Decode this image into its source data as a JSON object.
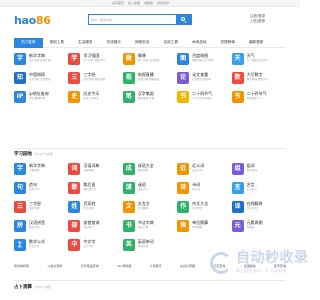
{
  "topbar": {
    "links": [
      "设为首页",
      "加入收藏",
      "电脑版",
      "商务合作"
    ]
  },
  "header": {
    "logo_text": "hao",
    "logo_num": "86",
    "search_placeholder": "网址 / 搜索内容",
    "right_text": "注册/登录",
    "right_sub": "入驻/推荐"
  },
  "tabs": [
    "热门推荐",
    "常用工具",
    "生活服务",
    "在线娱乐",
    "网络安全",
    "实用工具",
    "休闲游戏",
    "热搜榜单",
    "最新更新"
  ],
  "hot_sites": [
    {
      "title": "新华字典",
      "desc": "汉字查询 在线字典",
      "color": "#2a86e0",
      "glyph": "字"
    },
    {
      "title": "学习强国",
      "desc": "学习平台 在线学习",
      "color": "#e94d3f",
      "glyph": "学"
    },
    {
      "title": "微博",
      "desc": "热门话题 实时热搜",
      "color": "#f29400",
      "glyph": "微"
    },
    {
      "title": "百度地图",
      "desc": "地图导航 出行查询",
      "color": "#2a86e0",
      "glyph": "图"
    },
    {
      "title": "天气",
      "desc": "天气预报 实时天气",
      "color": "#33a0e8",
      "glyph": "天"
    },
    {
      "title": "中国知网",
      "desc": "学术文献 论文检索",
      "color": "#1f6fc5",
      "glyph": "知"
    },
    {
      "title": "三字经",
      "desc": "国学经典 启蒙读物",
      "color": "#e94d3f",
      "glyph": "三"
    },
    {
      "title": "电视直播",
      "desc": "在线直播 电视频道",
      "color": "#2fb26a",
      "glyph": "视"
    },
    {
      "title": "论文查重",
      "desc": "论文检测 重复率",
      "color": "#7a5cd6",
      "glyph": "论"
    },
    {
      "title": "大写数字",
      "desc": "数字转换 金额大写",
      "color": "#e94d3f",
      "glyph": "数"
    },
    {
      "title": "ip地址查询",
      "desc": "IP 归属地查询",
      "color": "#2a86e0",
      "glyph": "IP"
    },
    {
      "title": "历史今天",
      "desc": "历史上的今天",
      "color": "#f29400",
      "glyph": "史"
    },
    {
      "title": "汉字笔画",
      "desc": "笔画笔顺 查询",
      "color": "#2fb26a",
      "glyph": "笔"
    },
    {
      "title": "二十四节气",
      "desc": "节气大全 时间表",
      "color": "#f2b500",
      "glyph": "节"
    },
    {
      "title": "二十四节气",
      "desc": "中国传统 节气",
      "color": "#f29400",
      "glyph": "节"
    }
  ],
  "study": {
    "title": "学习园地",
    "sub": "共127个资源",
    "items": [
      {
        "title": "新华字典",
        "desc": "字典查询",
        "color": "#2a86e0",
        "glyph": "字"
      },
      {
        "title": "汉语词典",
        "desc": "词语查询",
        "color": "#e94d3f",
        "glyph": "词"
      },
      {
        "title": "成语大全",
        "desc": "成语查询",
        "color": "#2fb26a",
        "glyph": "成"
      },
      {
        "title": "近义词",
        "desc": "近反义词",
        "color": "#f29400",
        "glyph": "近"
      },
      {
        "title": "组词",
        "desc": "组词查询",
        "color": "#7a5cd6",
        "glyph": "组"
      },
      {
        "title": "造句",
        "desc": "造句大全",
        "color": "#2a86e0",
        "glyph": "句"
      },
      {
        "title": "歇后语",
        "desc": "歇后语大全",
        "color": "#e94d3f",
        "glyph": "歇"
      },
      {
        "title": "谜语",
        "desc": "谜语大全",
        "color": "#2fb26a",
        "glyph": "谜"
      },
      {
        "title": "诗词",
        "desc": "古诗词",
        "color": "#f29400",
        "glyph": "诗"
      },
      {
        "title": "名言",
        "desc": "名人名言",
        "color": "#33a0e8",
        "glyph": "言"
      },
      {
        "title": "三字经",
        "desc": "国学经典",
        "color": "#e94d3f",
        "glyph": "三"
      },
      {
        "title": "百家姓",
        "desc": "姓氏查询",
        "color": "#2a86e0",
        "glyph": "姓"
      },
      {
        "title": "文言文",
        "desc": "文言翻译",
        "color": "#f29400",
        "glyph": "文"
      },
      {
        "title": "作文大全",
        "desc": "优秀作文",
        "color": "#2fb26a",
        "glyph": "作"
      },
      {
        "title": "在线翻译",
        "desc": "中英互译",
        "color": "#1f6fc5",
        "glyph": "译"
      },
      {
        "title": "汉语拼音",
        "desc": "拼音查询",
        "color": "#2a86e0",
        "glyph": "拼"
      },
      {
        "title": "部首查询",
        "desc": "部首检字",
        "color": "#e94d3f",
        "glyph": "部"
      },
      {
        "title": "书法字典",
        "desc": "书法字体",
        "color": "#2fb26a",
        "glyph": "书"
      },
      {
        "title": "单位换算",
        "desc": "单位转换",
        "color": "#f29400",
        "glyph": "换"
      },
      {
        "title": "元素周期",
        "desc": "周期表",
        "color": "#7a5cd6",
        "glyph": "元"
      },
      {
        "title": "数学公式",
        "desc": "公式大全",
        "color": "#2a86e0",
        "glyph": "∑"
      },
      {
        "title": "中文字",
        "desc": "汉字大全",
        "color": "#e94d3f",
        "glyph": "中"
      },
      {
        "title": "英语单词",
        "desc": "单词查询",
        "color": "#2fb26a",
        "glyph": "英"
      }
    ],
    "links": [
      "繁简体转换",
      "火星文转换",
      "汉字笔画查询",
      "abc转换器",
      "大写数字",
      "在线计算器",
      "日历查询",
      "全国邮编",
      "区号查询"
    ]
  },
  "tools_title": "占卜测算",
  "tools_sub": "共52个资源",
  "watermark": {
    "big": "自动秒收录",
    "small": "做上链接 来访一次 自动收录"
  }
}
